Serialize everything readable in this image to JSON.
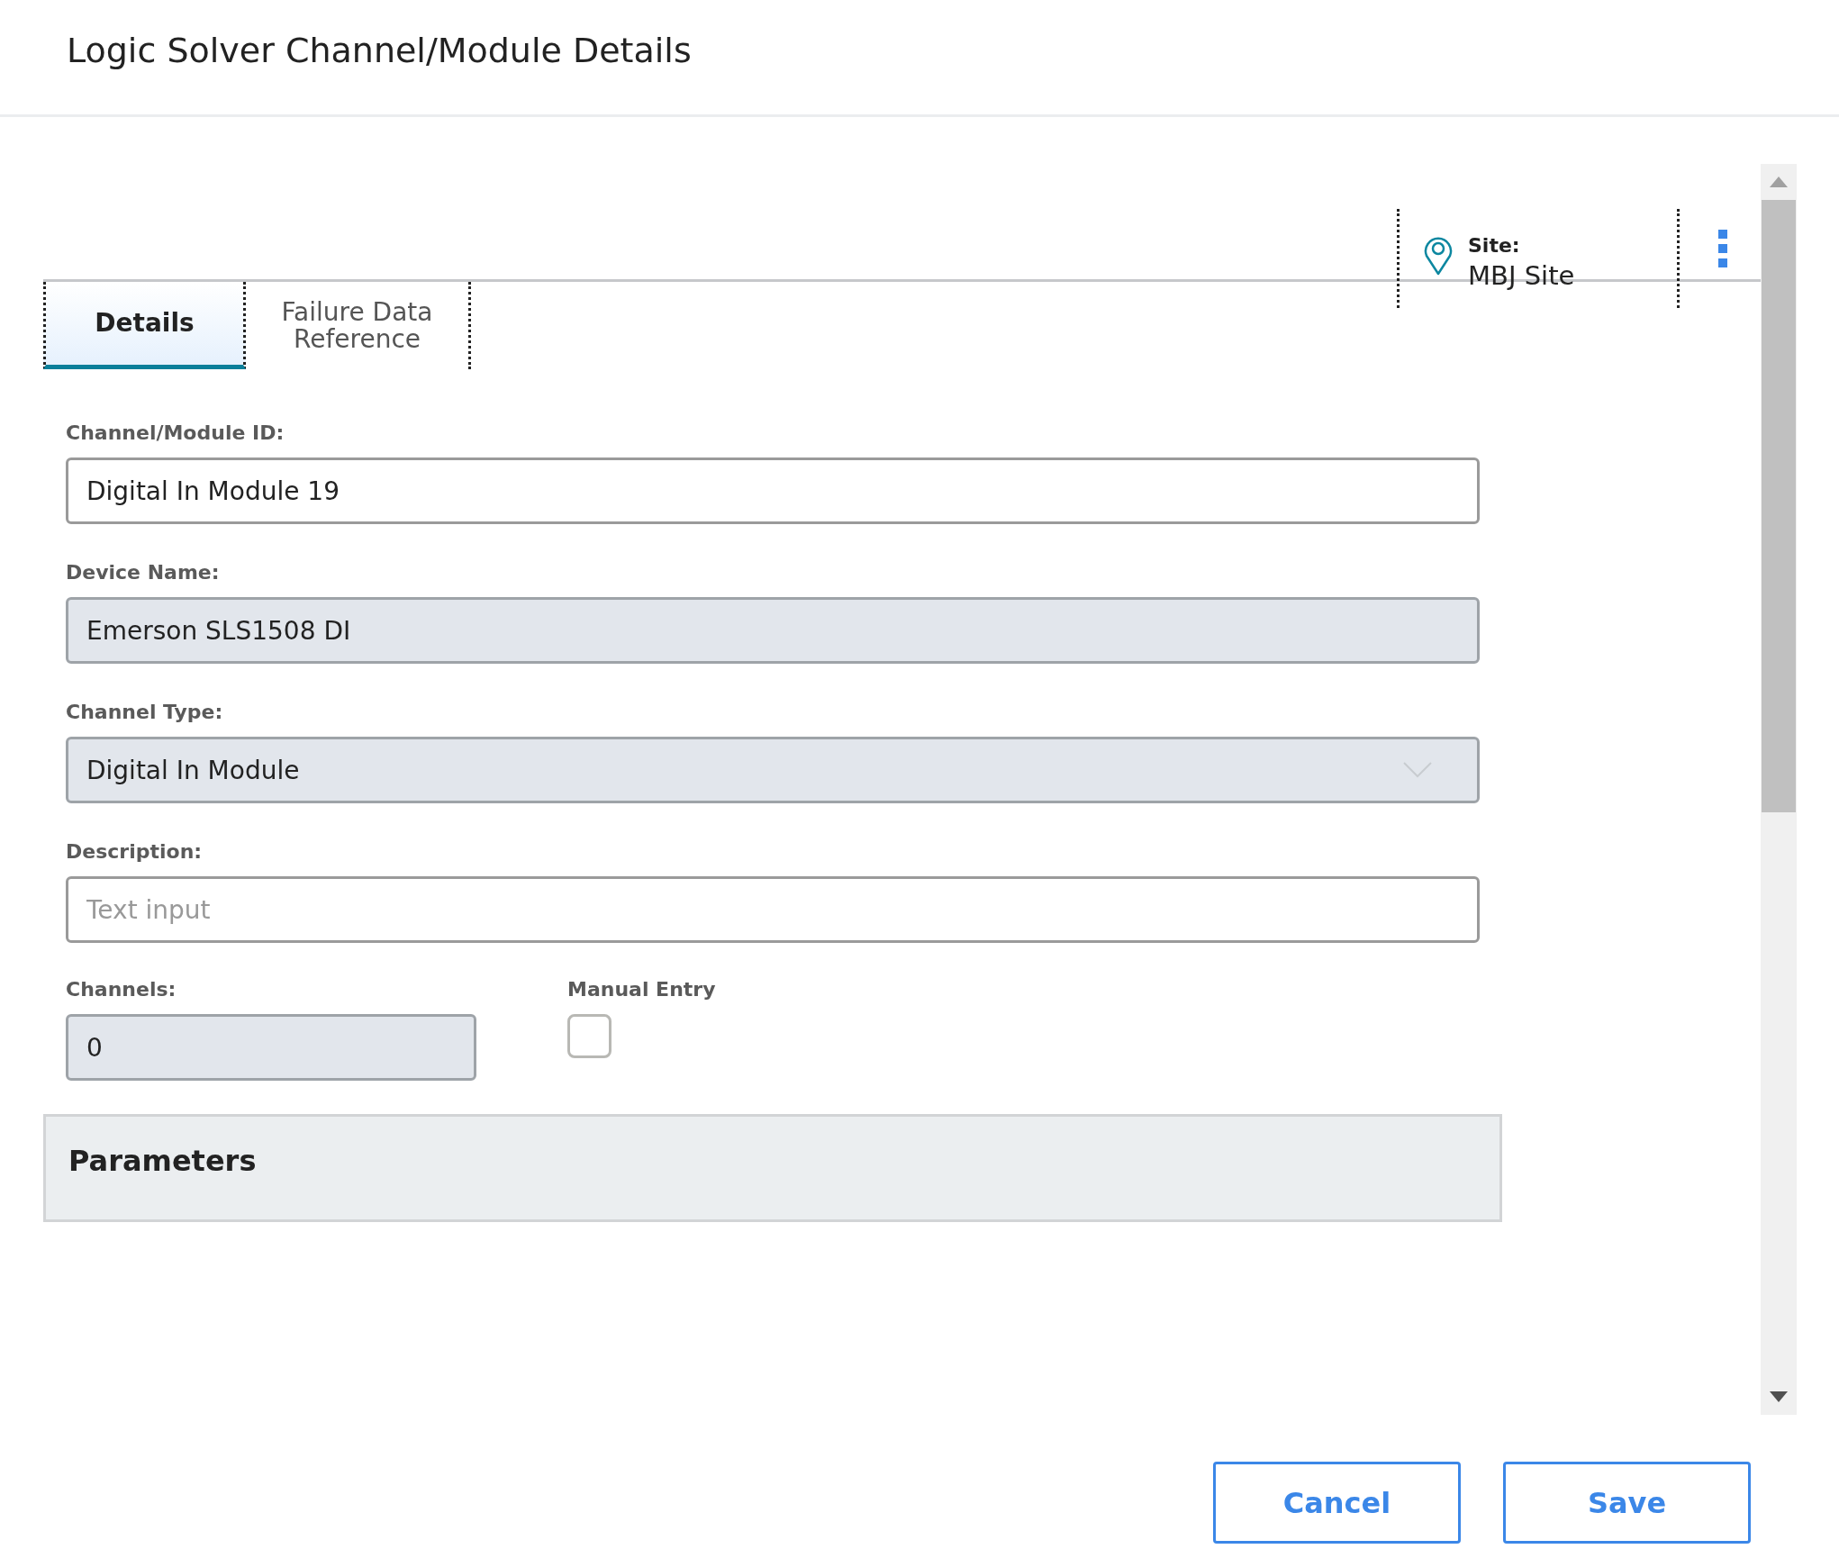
{
  "header": {
    "title": "Logic Solver Channel/Module Details"
  },
  "site": {
    "label": "Site:",
    "value": "MBJ Site"
  },
  "tabs": [
    {
      "label": "Details",
      "selected": true
    },
    {
      "label": "Failure Data Reference",
      "selected": false
    }
  ],
  "fields": [
    {
      "kind": "text",
      "label": "Channel/Module ID:",
      "value": "Digital In Module 19",
      "disabled": false
    },
    {
      "kind": "text",
      "label": "Device Name:",
      "value": "Emerson SLS1508 DI",
      "disabled": true
    },
    {
      "kind": "select",
      "label": "Channel Type:",
      "value": "Digital In Module",
      "disabled": true
    },
    {
      "kind": "text",
      "label": "Description:",
      "placeholder": "Text input",
      "disabled": false
    }
  ],
  "channels": {
    "label": "Channels:",
    "value": "0",
    "disabled": true
  },
  "manual_entry": {
    "label": "Manual Entry",
    "checked": false
  },
  "section": {
    "title": "Parameters"
  },
  "buttons": [
    {
      "label": "Cancel"
    },
    {
      "label": "Save"
    }
  ]
}
